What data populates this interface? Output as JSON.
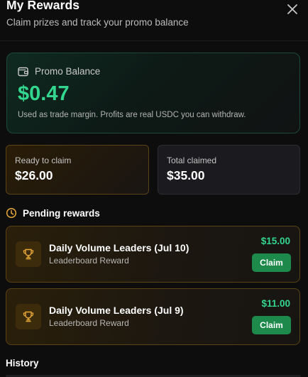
{
  "header": {
    "title": "My Rewards",
    "subtitle": "Claim prizes and track your promo balance",
    "close_icon": "close-icon"
  },
  "promo": {
    "icon": "wallet-icon",
    "label": "Promo Balance",
    "amount": "$0.47",
    "note": "Used as trade margin. Profits are real USDC you can withdraw."
  },
  "stats": {
    "ready": {
      "label": "Ready to claim",
      "value": "$26.00"
    },
    "total": {
      "label": "Total claimed",
      "value": "$35.00"
    }
  },
  "pending": {
    "icon": "clock-icon",
    "title": "Pending rewards",
    "items": [
      {
        "icon": "trophy-icon",
        "name": "Daily Volume Leaders (Jul 10)",
        "type": "Leaderboard Reward",
        "amount": "$15.00",
        "button": "Claim"
      },
      {
        "icon": "trophy-icon",
        "name": "Daily Volume Leaders (Jul 9)",
        "type": "Leaderboard Reward",
        "amount": "$11.00",
        "button": "Claim"
      }
    ]
  },
  "history": {
    "title": "History"
  },
  "colors": {
    "accent_green": "#33d68f",
    "claim_button": "#1d8a4c",
    "gold_border": "#5a4314",
    "icon_gold": "#e8a93a"
  }
}
